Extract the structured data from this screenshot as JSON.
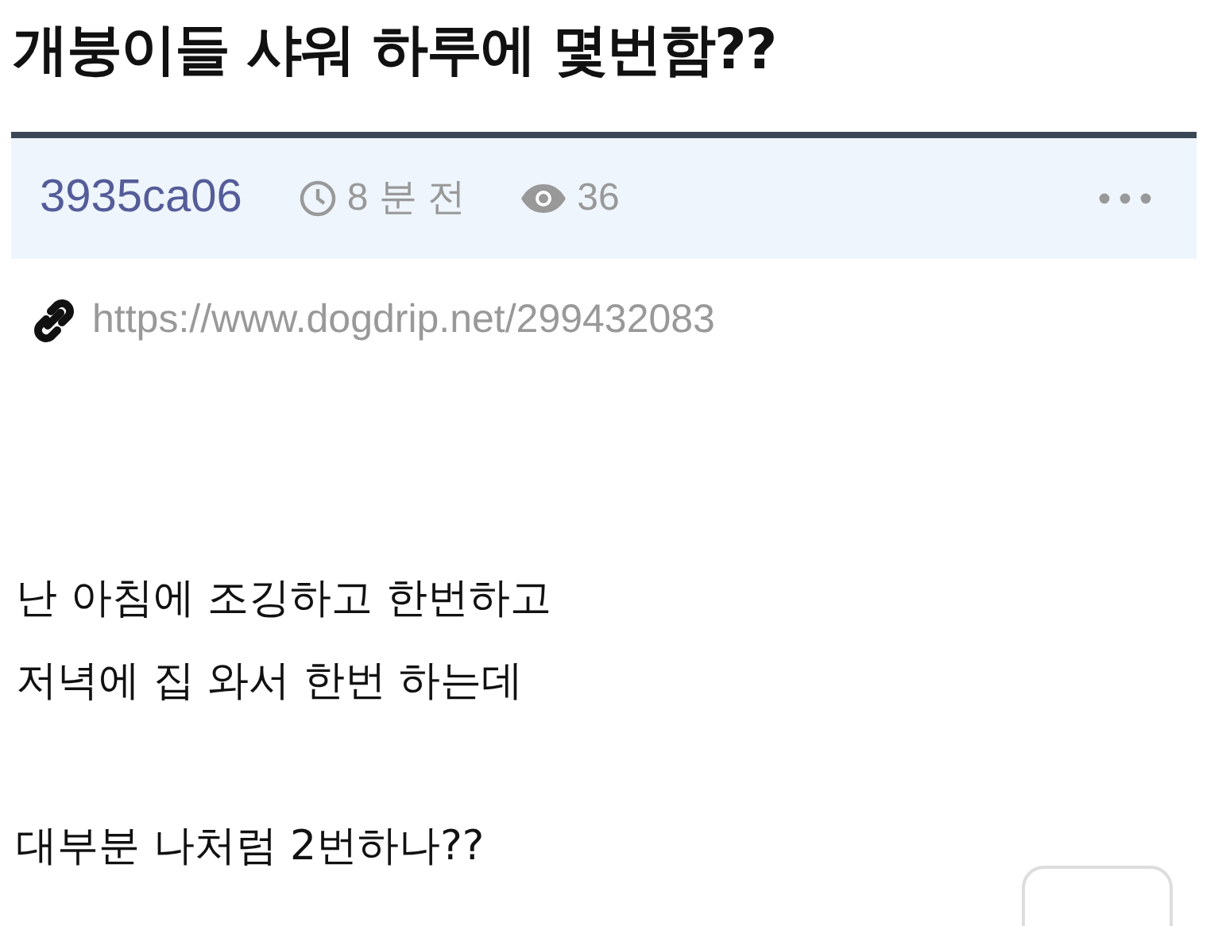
{
  "post": {
    "title": "개붕이들 샤워 하루에 몇번함??",
    "author": "3935ca06",
    "time": "8 분 전",
    "views": "36",
    "url": "https://www.dogdrip.net/299432083",
    "paragraphs": [
      [
        "난 아침에 조깅하고 한번하고",
        "저녁에 집 와서 한번 하는데"
      ],
      [
        "대부분 나처럼 2번하나??"
      ]
    ]
  }
}
